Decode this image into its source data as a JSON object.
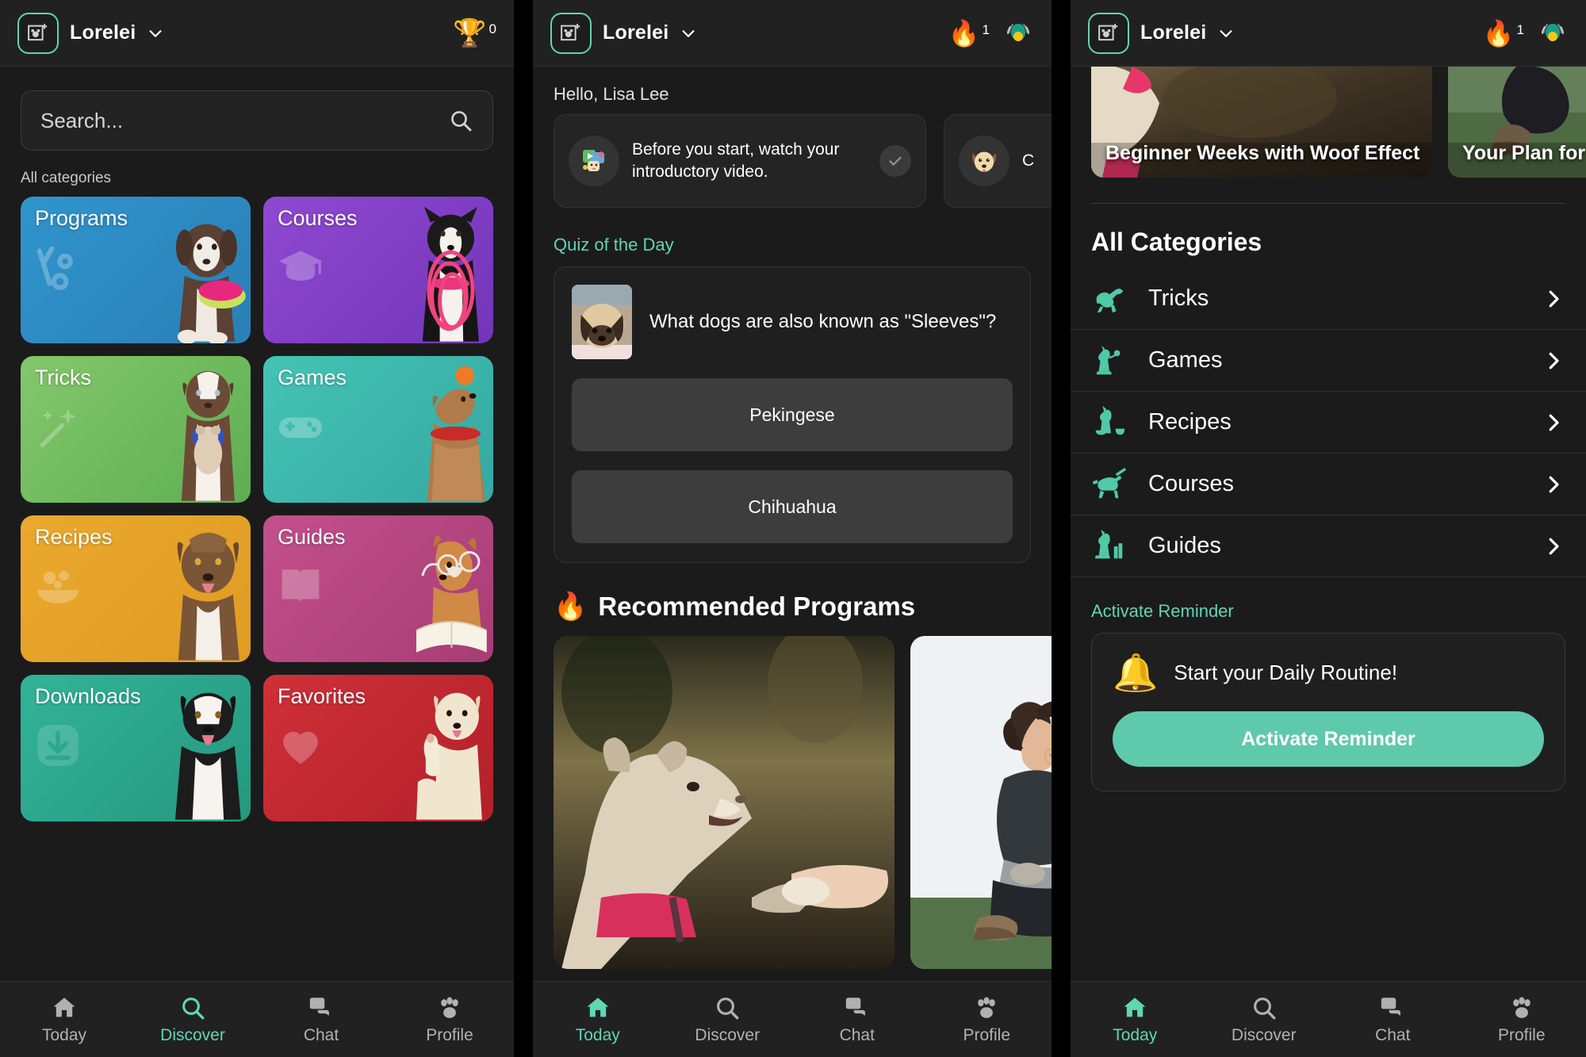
{
  "app": {
    "profile_name": "Lorelei",
    "accent_color": "#5fd6b4",
    "bg_color": "#1b1b1b"
  },
  "panel1": {
    "header": {
      "profile_name": "Lorelei",
      "trophy_icon": "trophy-icon",
      "trophy_count": "0"
    },
    "search": {
      "placeholder": "Search...",
      "value": "Search..."
    },
    "categories_label": "All categories",
    "cards": [
      {
        "label": "Programs",
        "color": "#2e8fc4",
        "icon": "shapes-icon"
      },
      {
        "label": "Courses",
        "color": "#8742c8",
        "icon": "graduation-cap-icon"
      },
      {
        "label": "Tricks",
        "color": "#74bd60",
        "icon": "magic-wand-icon"
      },
      {
        "label": "Games",
        "color": "#3dbcae",
        "icon": "gamepad-icon"
      },
      {
        "label": "Recipes",
        "color": "#e8a327",
        "icon": "food-bowl-icon"
      },
      {
        "label": "Guides",
        "color": "#bf4a82",
        "icon": "open-book-icon"
      },
      {
        "label": "Downloads",
        "color": "#2eab90",
        "icon": "download-icon"
      },
      {
        "label": "Favorites",
        "color": "#c62a31",
        "icon": "heart-icon"
      }
    ],
    "tabs": [
      {
        "label": "Today",
        "icon": "home-icon",
        "active": false
      },
      {
        "label": "Discover",
        "icon": "search-icon",
        "active": true
      },
      {
        "label": "Chat",
        "icon": "chat-icon",
        "active": false
      },
      {
        "label": "Profile",
        "icon": "paw-icon",
        "active": false
      }
    ]
  },
  "panel2": {
    "header": {
      "profile_name": "Lorelei",
      "flame_icon": "flame-icon",
      "streak_count": "1",
      "tracker_icon": "pet-tracker-icon"
    },
    "greeting": "Hello, Lisa Lee",
    "onboarding": [
      {
        "icon": "intro-video-icon",
        "text": "Before you start, watch your introductory video.",
        "status_icon": "check-circle-icon"
      },
      {
        "icon": "dog-face-icon",
        "text": "C"
      }
    ],
    "quiz": {
      "section_label": "Quiz of the Day",
      "thumb_icon": "pekingese-photo",
      "question": "What dogs are also known as \"Sleeves\"?",
      "options": [
        "Pekingese",
        "Chihuahua"
      ]
    },
    "recommended": {
      "emoji": "🔥",
      "title": "Recommended Programs",
      "cards": [
        {
          "image": "dog-paw-shake-photo"
        },
        {
          "image": "woman-kneeling-photo"
        }
      ]
    },
    "tabs": [
      {
        "label": "Today",
        "icon": "home-icon",
        "active": true
      },
      {
        "label": "Discover",
        "icon": "search-icon",
        "active": false
      },
      {
        "label": "Chat",
        "icon": "chat-icon",
        "active": false
      },
      {
        "label": "Profile",
        "icon": "paw-icon",
        "active": false
      }
    ]
  },
  "panel3": {
    "header": {
      "profile_name": "Lorelei",
      "flame_icon": "flame-icon",
      "streak_count": "1",
      "tracker_icon": "pet-tracker-icon"
    },
    "hero_cards": [
      {
        "title": "Beginner Weeks with Woof Effect",
        "image": "dog-fur-photo"
      },
      {
        "title": "Your Plan for",
        "image": "person-grass-photo"
      }
    ],
    "all_categories_title": "All Categories",
    "categories": [
      {
        "label": "Tricks",
        "icon": "dog-jumping-icon"
      },
      {
        "label": "Games",
        "icon": "dog-playing-icon"
      },
      {
        "label": "Recipes",
        "icon": "dog-bowl-icon"
      },
      {
        "label": "Courses",
        "icon": "dog-leash-icon"
      },
      {
        "label": "Guides",
        "icon": "dog-books-icon"
      }
    ],
    "reminder": {
      "section_label": "Activate Reminder",
      "emoji": "🔔",
      "text": "Start your Daily Routine!",
      "button_label": "Activate Reminder"
    },
    "tabs": [
      {
        "label": "Today",
        "icon": "home-icon",
        "active": true
      },
      {
        "label": "Discover",
        "icon": "search-icon",
        "active": false
      },
      {
        "label": "Chat",
        "icon": "chat-icon",
        "active": false
      },
      {
        "label": "Profile",
        "icon": "paw-icon",
        "active": false
      }
    ]
  }
}
